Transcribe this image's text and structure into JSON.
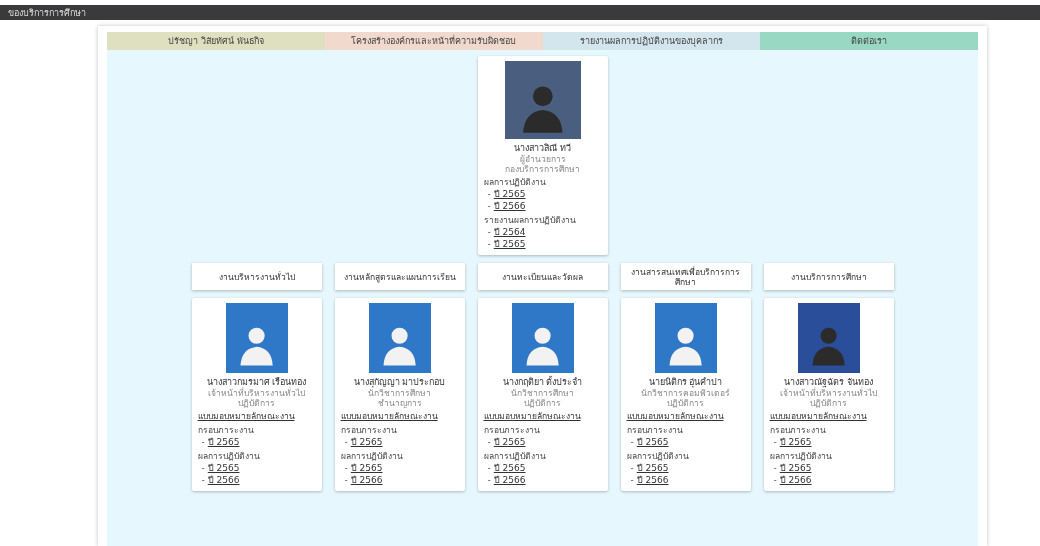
{
  "top_bar": {
    "title": "ของบริการการศึกษา"
  },
  "nav_tabs": [
    {
      "label": "ปรัชญา วิสัยทัศน์ พันธกิจ",
      "color": "#dfe0bf"
    },
    {
      "label": "โครงสร้างองค์กรและหน้าที่ความรับผิดชอบ",
      "color": "#f1d9cd"
    },
    {
      "label": "รายงานผลการปฏิบัติงานของบุคลากร",
      "color": "#d3e5ed"
    },
    {
      "label": "ติดต่อเรา",
      "color": "#99d8c2"
    }
  ],
  "director": {
    "name": "นางสาวสิณี ทวี",
    "position": [
      "ผู้อำนวยการ",
      "กองบริการการศึกษา"
    ],
    "items": [
      {
        "kind": "heading",
        "text": "ผลการปฏิบัติงาน"
      },
      {
        "kind": "year_link",
        "marker": "-",
        "text": "ปี 2565"
      },
      {
        "kind": "year_link",
        "marker": "-",
        "text": "ปี 2566"
      },
      {
        "kind": "heading",
        "text": "รายงานผลการปฏิบัติงาน"
      },
      {
        "kind": "year_link",
        "marker": "-",
        "text": "ปี 2564"
      },
      {
        "kind": "year_link",
        "marker": "-",
        "text": "ปี 2565"
      }
    ]
  },
  "departments": [
    "งานบริหารงานทั่วไป",
    "งานหลักสูตรและแผนการเรียน",
    "งานทะเบียนและวัดผล",
    "งานสารสนเทศเพื่อบริการการศึกษา",
    "งานบริการการศึกษา"
  ],
  "staff": [
    {
      "name": "นางสาวกมรมาศ เรือนทอง",
      "position": [
        "เจ้าหน้าที่บริหารงานทั่วไป",
        "ปฏิบัติการ"
      ],
      "items": [
        {
          "kind": "doc_link",
          "text": "แบบมอบหมายลักษณะงาน"
        },
        {
          "kind": "heading",
          "text": "กรอบภาระงาน"
        },
        {
          "kind": "year_link",
          "marker": "-",
          "text": "ปี 2565"
        },
        {
          "kind": "heading",
          "text": "ผลการปฏิบัติงาน"
        },
        {
          "kind": "year_link",
          "marker": "-",
          "text": "ปี 2565"
        },
        {
          "kind": "year_link",
          "marker": "-",
          "text": "ปี 2566"
        }
      ]
    },
    {
      "name": "นางสุกัญญา มาประกอบ",
      "position": [
        "นักวิชาการศึกษา",
        "ชำนาญการ"
      ],
      "items": [
        {
          "kind": "doc_link",
          "text": "แบบมอบหมายลักษณะงาน"
        },
        {
          "kind": "heading",
          "text": "กรอบภาระงาน"
        },
        {
          "kind": "year_link",
          "marker": "-",
          "text": "ปี 2565"
        },
        {
          "kind": "heading",
          "text": "ผลการปฏิบัติงาน"
        },
        {
          "kind": "year_link",
          "marker": "-",
          "text": "ปี 2565"
        },
        {
          "kind": "year_link",
          "marker": "-",
          "text": "ปี 2566"
        }
      ]
    },
    {
      "name": "นางกฤติยา ตั้งประจำ",
      "position": [
        "นักวิชาการศึกษา",
        "ปฏิบัติการ"
      ],
      "items": [
        {
          "kind": "doc_link",
          "text": "แบบมอบหมายลักษณะงาน"
        },
        {
          "kind": "heading",
          "text": "กรอบภาระงาน"
        },
        {
          "kind": "year_link",
          "marker": "-",
          "text": "ปี 2565"
        },
        {
          "kind": "heading",
          "text": "ผลการปฏิบัติงาน"
        },
        {
          "kind": "year_link",
          "marker": "-",
          "text": "ปี 2565"
        },
        {
          "kind": "year_link",
          "marker": "-",
          "text": "ปี 2566"
        }
      ]
    },
    {
      "name": "นายนิติกร อุ่นคำปา",
      "position": [
        "นักวิชาการคอมพิวเตอร์",
        "ปฏิบัติการ"
      ],
      "items": [
        {
          "kind": "doc_link",
          "text": "แบบมอบหมายลักษณะงาน"
        },
        {
          "kind": "heading",
          "text": "กรอบภาระงาน"
        },
        {
          "kind": "year_link",
          "marker": "-",
          "text": "ปี 2565"
        },
        {
          "kind": "heading",
          "text": "ผลการปฏิบัติงาน"
        },
        {
          "kind": "year_link",
          "marker": "-",
          "text": "ปี 2565"
        },
        {
          "kind": "year_link",
          "marker": "-",
          "text": "ปี 2566"
        }
      ]
    },
    {
      "name": "นางสาวณัฐฉัตร จันทอง",
      "position": [
        "เจ้าหน้าที่บริหารงานทั่วไป",
        "ปฏิบัติการ"
      ],
      "items": [
        {
          "kind": "doc_link",
          "text": "แบบมอบหมายลักษณะงาน"
        },
        {
          "kind": "heading",
          "text": "กรอบภาระงาน"
        },
        {
          "kind": "year_link",
          "marker": "-",
          "text": "ปี 2565"
        },
        {
          "kind": "heading",
          "text": "ผลการปฏิบัติงาน"
        },
        {
          "kind": "year_link",
          "marker": "-",
          "text": "ปี 2565"
        },
        {
          "kind": "year_link",
          "marker": "-",
          "text": "ปี 2566"
        }
      ]
    }
  ]
}
